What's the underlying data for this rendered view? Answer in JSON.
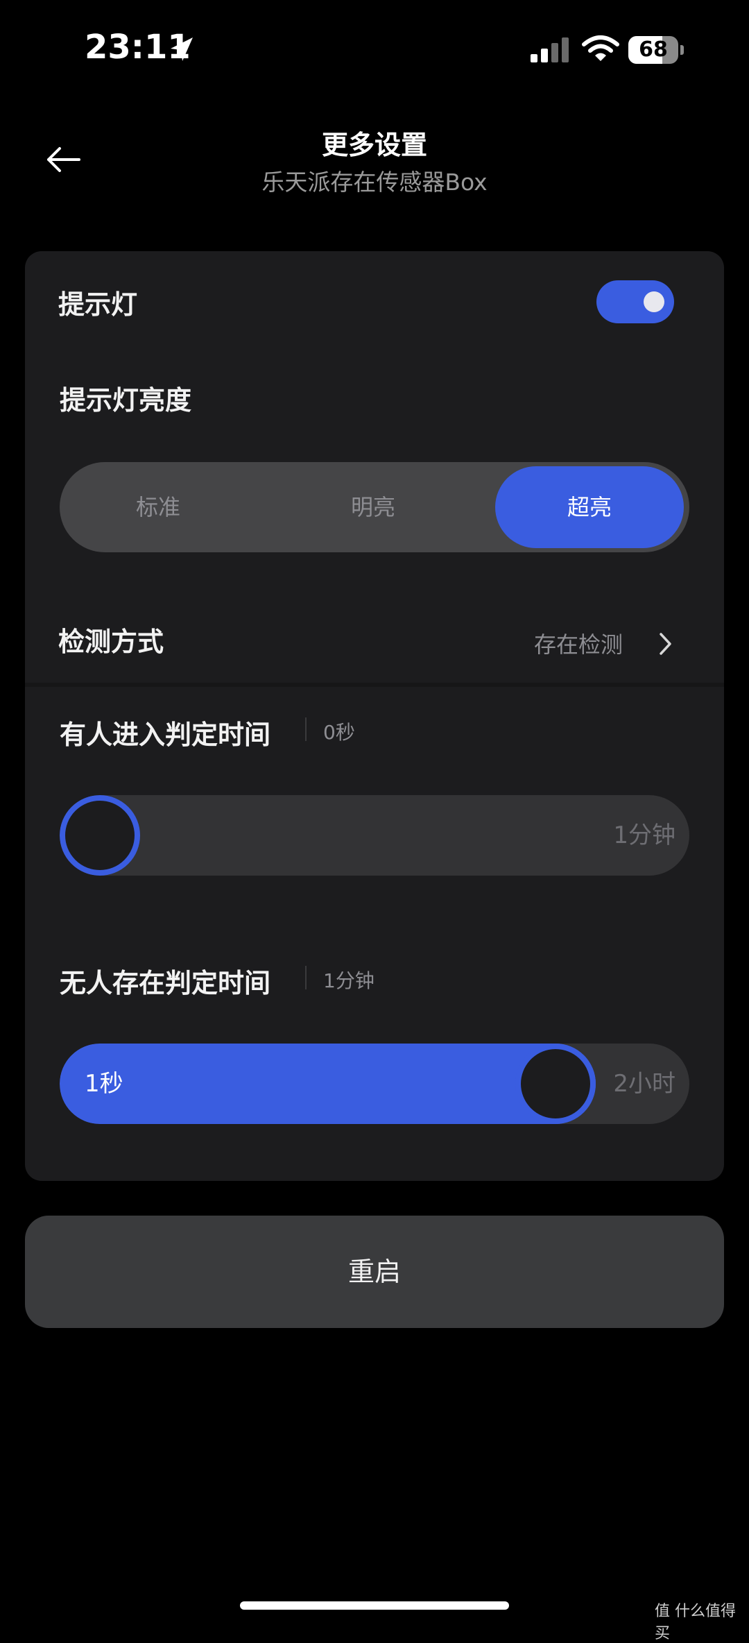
{
  "status_bar": {
    "time": "23:11",
    "battery": "68",
    "battery_level": 0.68,
    "icons": [
      "location-arrow-icon",
      "cellular-signal-icon",
      "wifi-icon",
      "battery-icon"
    ]
  },
  "header": {
    "back_icon": "arrow-left-icon",
    "title": "更多设置",
    "subtitle": "乐天派存在传感器Box"
  },
  "settings": {
    "indicator_light_label": "提示灯",
    "indicator_light_on": true,
    "brightness_label": "提示灯亮度",
    "brightness_options": [
      "标准",
      "明亮",
      "超亮"
    ],
    "brightness_selected": "超亮",
    "detection_label": "检测方式",
    "detection_value": "存在检测",
    "enter_time_label": "有人进入判定时间",
    "enter_time_value": "0秒",
    "enter_time_max": "1分钟",
    "enter_time_fraction": 0,
    "absent_time_label": "无人存在判定时间",
    "absent_time_value": "1分钟",
    "absent_time_min": "1秒",
    "absent_time_max": "2小时",
    "absent_time_fraction": 0.83
  },
  "restart_label": "重启",
  "accent_color": "#3a5de0",
  "watermark": "值 什么值得买"
}
